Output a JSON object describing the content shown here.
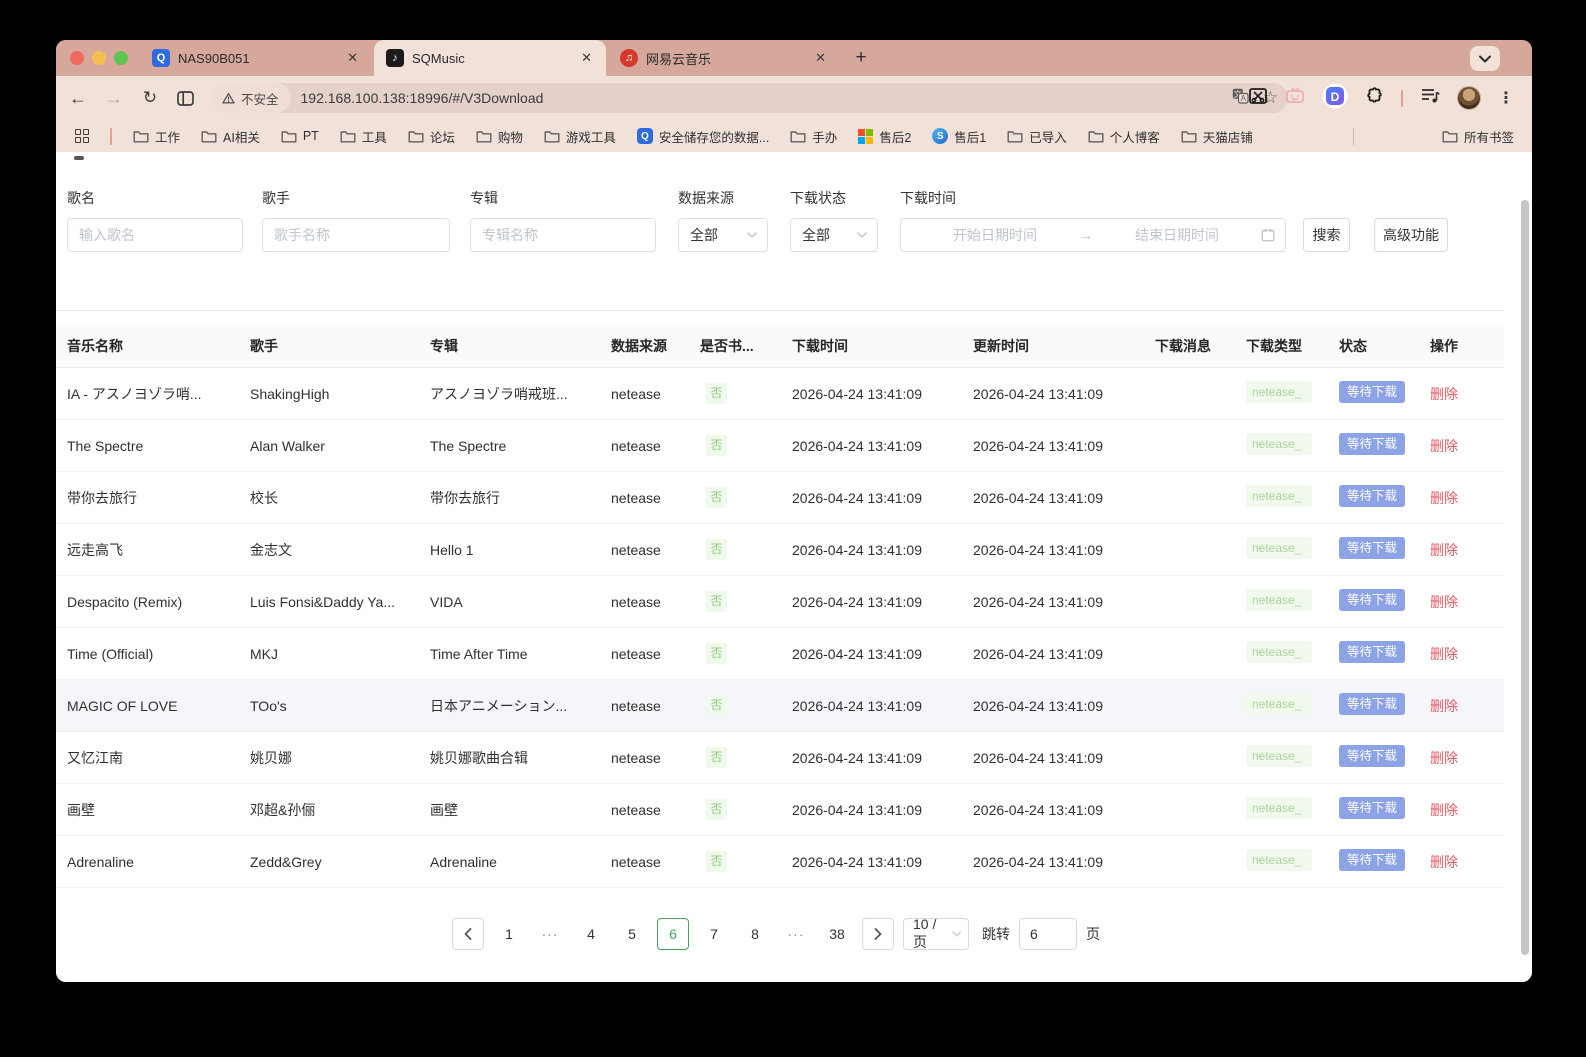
{
  "icons": {
    "close": "✕",
    "new_tab": "+",
    "back": "←",
    "forward": "→",
    "reload": "↻",
    "star": "☆",
    "more": "⋮",
    "range_arrow": "→",
    "tab1_glyph": "Q",
    "tab2_glyph": "♪",
    "tab3_glyph": "♫",
    "q_glyph": "Q",
    "coin_glyph": "S"
  },
  "colors": {
    "tabstrip": "#d5a89b",
    "chrome": "#f2e1d9",
    "status_blue": "#8ca3e6",
    "badge_green_bg": "#f0f9ec",
    "badge_green_text": "#8fcb80",
    "danger_red": "#e25a66",
    "accent_green": "#43a55f"
  },
  "browser": {
    "tabs": [
      {
        "title": "NAS90B051"
      },
      {
        "title": "SQMusic"
      },
      {
        "title": "网易云音乐"
      }
    ],
    "address": {
      "security_label": "不安全",
      "url": "192.168.100.138:18996/#/V3Download"
    },
    "bookmarks": {
      "items": [
        {
          "label": "工作"
        },
        {
          "label": "AI相关"
        },
        {
          "label": "PT"
        },
        {
          "label": "工具"
        },
        {
          "label": "论坛"
        },
        {
          "label": "购物"
        },
        {
          "label": "游戏工具"
        },
        {
          "label": "安全储存您的数据..."
        },
        {
          "label": "手办"
        },
        {
          "label": "售后2"
        },
        {
          "label": "售后1"
        },
        {
          "label": "已导入"
        },
        {
          "label": "个人博客"
        },
        {
          "label": "天猫店铺"
        }
      ],
      "all_bookmarks": "所有书签"
    }
  },
  "filters": {
    "song": {
      "label": "歌名",
      "placeholder": "输入歌名"
    },
    "artist": {
      "label": "歌手",
      "placeholder": "歌手名称"
    },
    "album": {
      "label": "专辑",
      "placeholder": "专辑名称"
    },
    "source": {
      "label": "数据来源",
      "value": "全部"
    },
    "status": {
      "label": "下载状态",
      "value": "全部"
    },
    "time": {
      "label": "下载时间",
      "start_placeholder": "开始日期时间",
      "end_placeholder": "结束日期时间"
    },
    "search_label": "搜索",
    "advanced_label": "高级功能"
  },
  "table": {
    "columns": [
      "音乐名称",
      "歌手",
      "专辑",
      "数据来源",
      "是否书...",
      "下载时间",
      "更新时间",
      "下载消息",
      "下载类型",
      "状态",
      "操作"
    ],
    "rows": [
      {
        "name": "IA - アスノヨゾラ哨...",
        "artist": "ShakingHigh",
        "album": "アスノヨゾラ哨戒班...",
        "source": "netease",
        "bookmarked": "否",
        "download_time": "2026-04-24 13:41:09",
        "update_time": "2026-04-24 13:41:09",
        "message": "",
        "type": "netease_",
        "status": "等待下载",
        "action": "删除"
      },
      {
        "name": "The Spectre",
        "artist": "Alan Walker",
        "album": "The Spectre",
        "source": "netease",
        "bookmarked": "否",
        "download_time": "2026-04-24 13:41:09",
        "update_time": "2026-04-24 13:41:09",
        "message": "",
        "type": "netease_",
        "status": "等待下载",
        "action": "删除"
      },
      {
        "name": "带你去旅行",
        "artist": "校长",
        "album": "带你去旅行",
        "source": "netease",
        "bookmarked": "否",
        "download_time": "2026-04-24 13:41:09",
        "update_time": "2026-04-24 13:41:09",
        "message": "",
        "type": "netease_",
        "status": "等待下载",
        "action": "删除"
      },
      {
        "name": "远走高飞",
        "artist": "金志文",
        "album": "Hello 1",
        "source": "netease",
        "bookmarked": "否",
        "download_time": "2026-04-24 13:41:09",
        "update_time": "2026-04-24 13:41:09",
        "message": "",
        "type": "netease_",
        "status": "等待下载",
        "action": "删除"
      },
      {
        "name": "Despacito (Remix)",
        "artist": "Luis Fonsi&Daddy Ya...",
        "album": "VIDA",
        "source": "netease",
        "bookmarked": "否",
        "download_time": "2026-04-24 13:41:09",
        "update_time": "2026-04-24 13:41:09",
        "message": "",
        "type": "netease_",
        "status": "等待下载",
        "action": "删除"
      },
      {
        "name": "Time (Official)",
        "artist": "MKJ",
        "album": "Time After Time",
        "source": "netease",
        "bookmarked": "否",
        "download_time": "2026-04-24 13:41:09",
        "update_time": "2026-04-24 13:41:09",
        "message": "",
        "type": "netease_",
        "status": "等待下载",
        "action": "删除"
      },
      {
        "name": "MAGIC OF LOVE",
        "artist": "TOo's",
        "album": "日本アニメーション...",
        "source": "netease",
        "bookmarked": "否",
        "download_time": "2026-04-24 13:41:09",
        "update_time": "2026-04-24 13:41:09",
        "message": "",
        "type": "netease_",
        "status": "等待下载",
        "action": "删除"
      },
      {
        "name": "又忆江南",
        "artist": "姚贝娜",
        "album": "姚贝娜歌曲合辑",
        "source": "netease",
        "bookmarked": "否",
        "download_time": "2026-04-24 13:41:09",
        "update_time": "2026-04-24 13:41:09",
        "message": "",
        "type": "netease_",
        "status": "等待下载",
        "action": "删除"
      },
      {
        "name": "画壁",
        "artist": "邓超&孙俪",
        "album": "画壁",
        "source": "netease",
        "bookmarked": "否",
        "download_time": "2026-04-24 13:41:09",
        "update_time": "2026-04-24 13:41:09",
        "message": "",
        "type": "netease_",
        "status": "等待下载",
        "action": "删除"
      },
      {
        "name": "Adrenaline",
        "artist": "Zedd&Grey",
        "album": "Adrenaline",
        "source": "netease",
        "bookmarked": "否",
        "download_time": "2026-04-24 13:41:09",
        "update_time": "2026-04-24 13:41:09",
        "message": "",
        "type": "netease_",
        "status": "等待下载",
        "action": "删除"
      }
    ]
  },
  "pagination": {
    "pages": [
      "1",
      "···",
      "4",
      "5",
      "6",
      "7",
      "8",
      "···",
      "38"
    ],
    "active_page": "6",
    "page_size": "10 / 页",
    "jump_label": "跳转",
    "jump_value": "6",
    "unit_label": "页"
  }
}
